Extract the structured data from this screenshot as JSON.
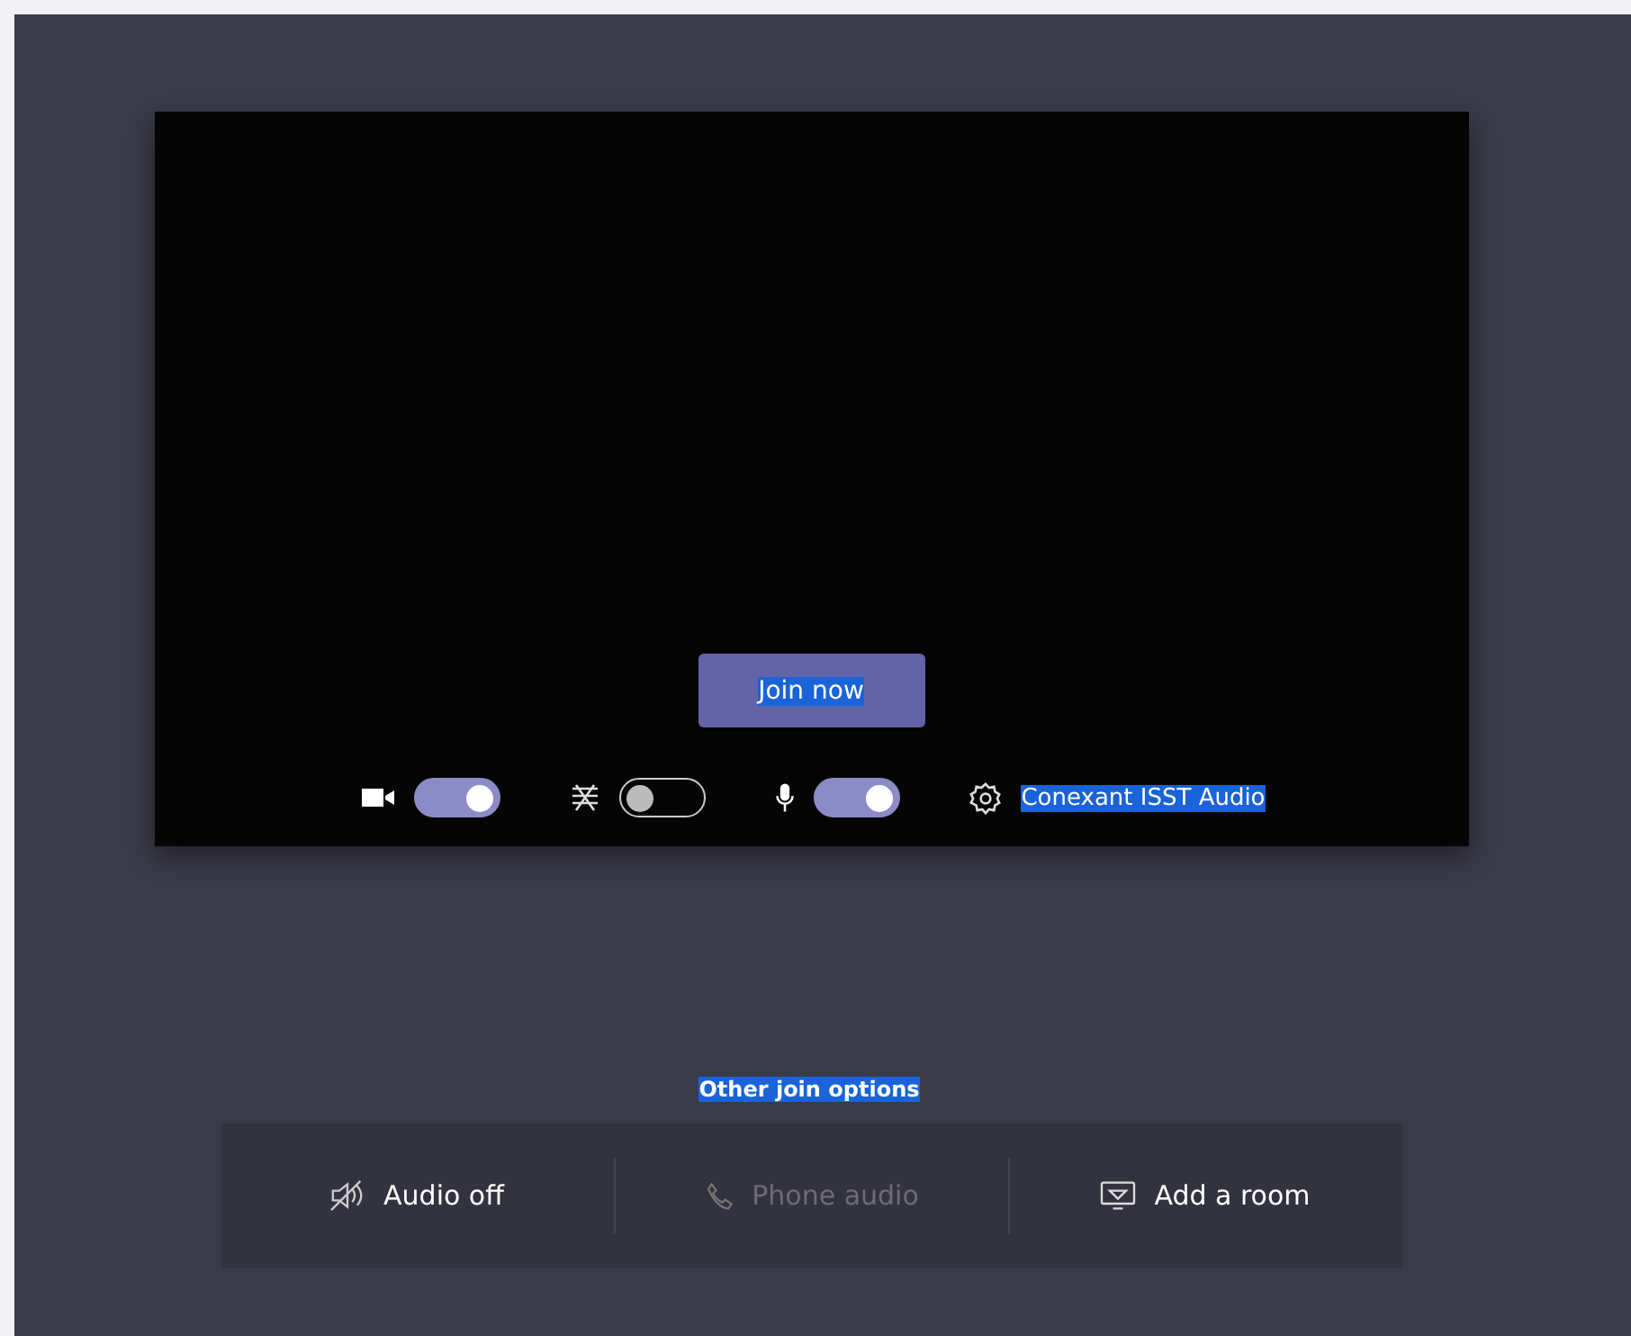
{
  "preview": {
    "join_button": {
      "label": "Join now",
      "text_selected": true
    },
    "controls": [
      {
        "kind": "camera",
        "on": true
      },
      {
        "kind": "blur",
        "on": false
      },
      {
        "kind": "mic",
        "on": true
      }
    ],
    "device": {
      "label": "Conexant ISST Audio",
      "text_selected": true
    }
  },
  "other_join_options": {
    "label": "Other join options",
    "text_selected": true
  },
  "options": [
    {
      "kind": "audio-off",
      "label": "Audio off",
      "disabled": false
    },
    {
      "kind": "phone",
      "label": "Phone audio",
      "disabled": true
    },
    {
      "kind": "room",
      "label": "Add a room",
      "disabled": false
    }
  ]
}
